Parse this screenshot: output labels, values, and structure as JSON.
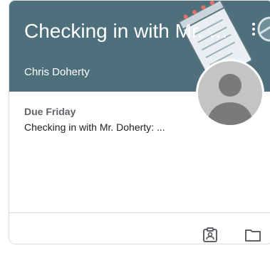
{
  "card": {
    "title": "Checking in with Mr. Doherty",
    "teacher": "Chris Doherty",
    "header_color": "#4e707c",
    "due_label": "Due Friday",
    "assignment_title": "Checking in with Mr. Doherty: ..."
  },
  "icons": {
    "more": "more-vert-icon",
    "avatar": "person-avatar",
    "work": "assignment-ind-icon",
    "folder": "folder-icon"
  }
}
